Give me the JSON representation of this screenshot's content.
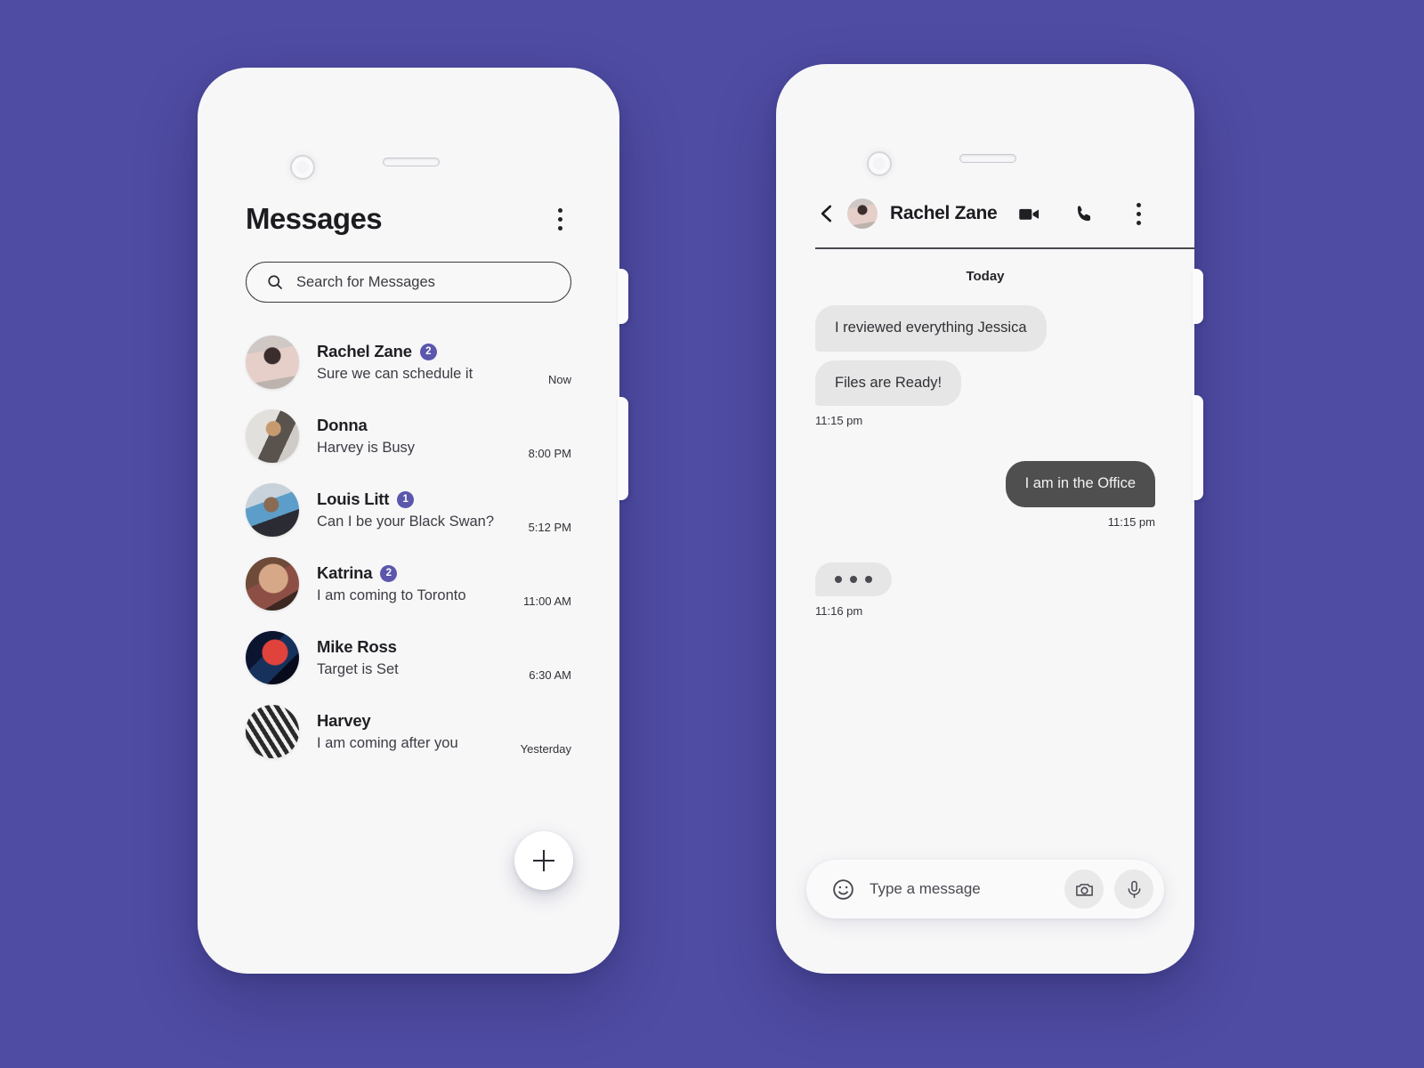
{
  "theme": {
    "background": "#4f4ca4",
    "screen_bg": "#f7f7f8",
    "accent_badge": "#5b57ad",
    "bubble_in": "#e6e6e6",
    "bubble_out": "#4f4f4f"
  },
  "messages_screen": {
    "title": "Messages",
    "menu_icon": "kebab-menu-icon",
    "search": {
      "icon": "search-icon",
      "placeholder": "Search for Messages",
      "value": ""
    },
    "conversations": [
      {
        "name": "Rachel Zane",
        "snippet": "Sure we can schedule it",
        "time": "Now",
        "badge": "2",
        "avatar": "av1"
      },
      {
        "name": "Donna",
        "snippet": "Harvey is Busy",
        "time": "8:00 PM",
        "badge": "",
        "avatar": "av2"
      },
      {
        "name": "Louis Litt",
        "snippet": "Can I be your Black Swan?",
        "time": "5:12 PM",
        "badge": "1",
        "avatar": "av3"
      },
      {
        "name": "Katrina",
        "snippet": "I am coming to Toronto",
        "time": "11:00 AM",
        "badge": "2",
        "avatar": "av4"
      },
      {
        "name": "Mike Ross",
        "snippet": "Target is Set",
        "time": "6:30 AM",
        "badge": "",
        "avatar": "av5"
      },
      {
        "name": "Harvey",
        "snippet": "I am coming after you",
        "time": "Yesterday",
        "badge": "",
        "avatar": "av6"
      }
    ],
    "fab": {
      "icon": "plus-icon",
      "label": ""
    }
  },
  "chat_screen": {
    "header": {
      "back_icon": "back-chevron-icon",
      "contact_name": "Rachel Zane",
      "video_icon": "video-camera-icon",
      "call_icon": "phone-call-icon",
      "menu_icon": "kebab-menu-icon"
    },
    "day_divider": "Today",
    "messages": [
      {
        "direction": "in",
        "text": "I reviewed everything Jessica",
        "time": ""
      },
      {
        "direction": "in",
        "text": "Files are Ready!",
        "time": "11:15 pm"
      },
      {
        "direction": "out",
        "text": "I am in the Office",
        "time": "11:15 pm"
      },
      {
        "direction": "in",
        "text": "",
        "time": "11:16 pm",
        "typing": true
      }
    ],
    "composer": {
      "emoji_icon": "smiley-face-icon",
      "placeholder": "Type a message",
      "value": "",
      "camera_icon": "camera-icon",
      "mic_icon": "microphone-icon"
    }
  }
}
